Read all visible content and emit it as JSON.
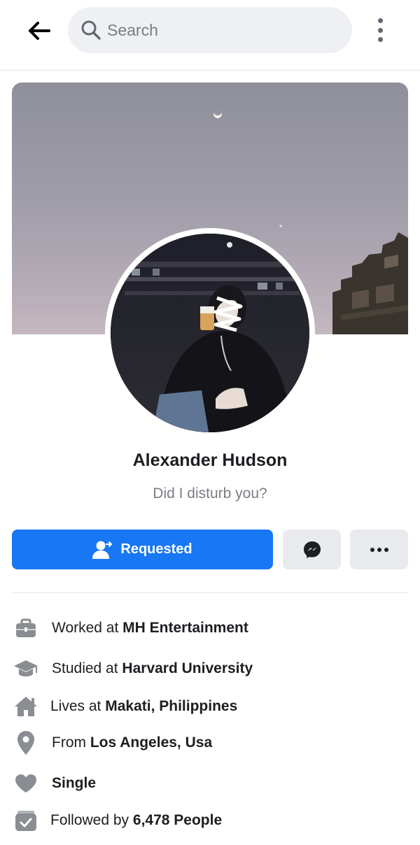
{
  "header": {
    "search_placeholder": "Search",
    "back_icon": "arrow-left-icon",
    "menu_icon": "more-vertical-icon"
  },
  "profile": {
    "name": "Alexander Hudson",
    "bio": "Did I disturb you?"
  },
  "actions": {
    "primary_label": "Requested",
    "primary_icon": "user-requested-icon",
    "message_icon": "messenger-icon",
    "more_icon": "more-horizontal-icon"
  },
  "about": [
    {
      "icon": "briefcase-icon",
      "prefix": "Worked at",
      "value": "MH Entertainment"
    },
    {
      "icon": "graduation-cap-icon",
      "prefix": "Studied at",
      "value": "Harvard University"
    },
    {
      "icon": "home-icon",
      "prefix": "Lives at",
      "value": "Makati, Philippines"
    },
    {
      "icon": "location-pin-icon",
      "prefix": "From",
      "value": "Los Angeles, Usa"
    },
    {
      "icon": "heart-icon",
      "prefix": "",
      "value": "Single"
    },
    {
      "icon": "followers-icon",
      "prefix": "Followed by",
      "value": "6,478 People"
    }
  ],
  "colors": {
    "accent": "#1877f2",
    "icon_gray": "#8a8d91",
    "secondary_button": "#e9eaee"
  }
}
